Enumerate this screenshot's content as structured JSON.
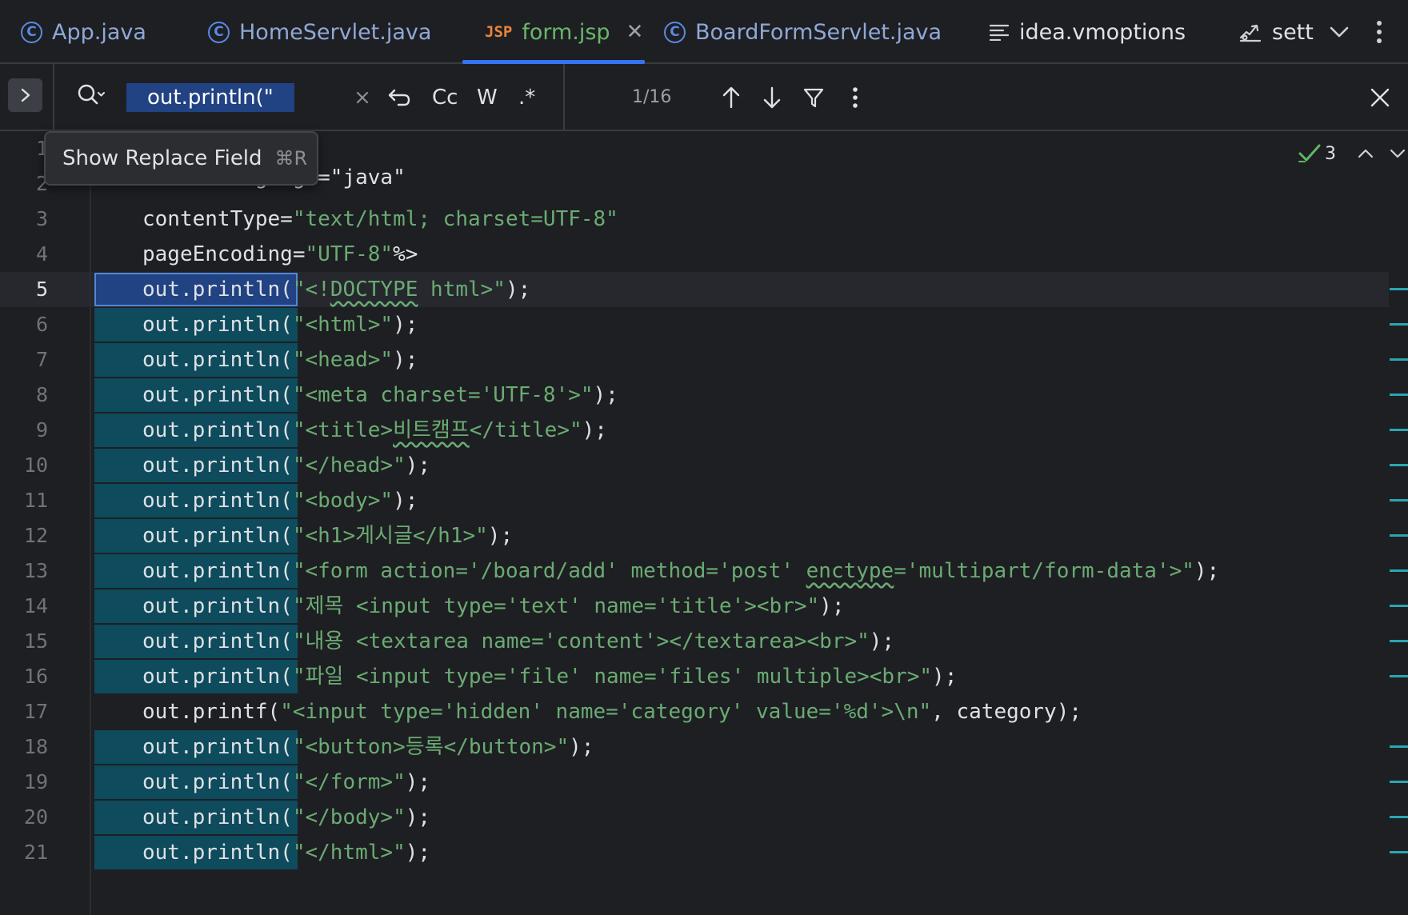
{
  "tabs": [
    {
      "label": "App.java",
      "icon": "class-icon",
      "active": false
    },
    {
      "label": "HomeServlet.java",
      "icon": "class-icon",
      "active": false
    },
    {
      "label": "form.jsp",
      "icon": "jsp-icon",
      "active": true
    },
    {
      "label": "BoardFormServlet.java",
      "icon": "class-icon",
      "active": false
    },
    {
      "label": "idea.vmoptions",
      "icon": "text-file-icon",
      "active": false
    },
    {
      "label": "sett",
      "icon": "settings-file-icon",
      "active": false
    }
  ],
  "icons": {
    "class_glyph": "C",
    "jsp_glyph": "JSP"
  },
  "find": {
    "query": "out.println(\"",
    "case_label": "Cc",
    "word_label": "W",
    "regex_label": ".*",
    "match_count": "1/16"
  },
  "tooltip": {
    "label": "Show Replace Field",
    "shortcut": "⌘R"
  },
  "inspection": {
    "count": "3"
  },
  "editor": {
    "current_line": 5,
    "partial_line_2": "language=\"java\"",
    "lines": [
      {
        "num": "1",
        "prefix": "",
        "rest": "",
        "match": false
      },
      {
        "num": "2",
        "prefix": "",
        "rest": "",
        "match": false
      },
      {
        "num": "3",
        "prefix": "contentType=",
        "rest": "\"text/html; charset=UTF-8\"",
        "match": false
      },
      {
        "num": "4",
        "prefix": "pageEncoding=",
        "rest": "\"UTF-8\"%>",
        "match": false
      },
      {
        "num": "5",
        "prefix": "out.println(",
        "rest": "\"<!DOCTYPE html>\");",
        "match": true
      },
      {
        "num": "6",
        "prefix": "out.println(",
        "rest": "\"<html>\");",
        "match": true
      },
      {
        "num": "7",
        "prefix": "out.println(",
        "rest": "\"<head>\");",
        "match": true
      },
      {
        "num": "8",
        "prefix": "out.println(",
        "rest": "\"<meta charset='UTF-8'>\");",
        "match": true
      },
      {
        "num": "9",
        "prefix": "out.println(",
        "rest": "\"<title>비트캠프</title>\");",
        "match": true
      },
      {
        "num": "10",
        "prefix": "out.println(",
        "rest": "\"</head>\");",
        "match": true
      },
      {
        "num": "11",
        "prefix": "out.println(",
        "rest": "\"<body>\");",
        "match": true
      },
      {
        "num": "12",
        "prefix": "out.println(",
        "rest": "\"<h1>게시글</h1>\");",
        "match": true
      },
      {
        "num": "13",
        "prefix": "out.println(",
        "rest": "\"<form action='/board/add' method='post' enctype='multipart/form-data'>\");",
        "match": true
      },
      {
        "num": "14",
        "prefix": "out.println(",
        "rest": "\"제목 <input type='text' name='title'><br>\");",
        "match": true
      },
      {
        "num": "15",
        "prefix": "out.println(",
        "rest": "\"내용 <textarea name='content'></textarea><br>\");",
        "match": true
      },
      {
        "num": "16",
        "prefix": "out.println(",
        "rest": "\"파일 <input type='file' name='files' multiple><br>\");",
        "match": true
      },
      {
        "num": "17",
        "prefix": "out.printf(",
        "rest": "\"<input type='hidden' name='category' value='%d'>\\n\", category);",
        "match": false
      },
      {
        "num": "18",
        "prefix": "out.println(",
        "rest": "\"<button>등록</button>\");",
        "match": true
      },
      {
        "num": "19",
        "prefix": "out.println(",
        "rest": "\"</form>\");",
        "match": true
      },
      {
        "num": "20",
        "prefix": "out.println(",
        "rest": "\"</body>\");",
        "match": true
      },
      {
        "num": "21",
        "prefix": "out.println(",
        "rest": "\"</html>\");",
        "match": true
      }
    ]
  },
  "colors": {
    "background": "#1e1f22",
    "match_highlight": "#0e4b5c",
    "current_match": "#214283",
    "string": "#6aab73",
    "tab_active_underline": "#3574f0"
  }
}
